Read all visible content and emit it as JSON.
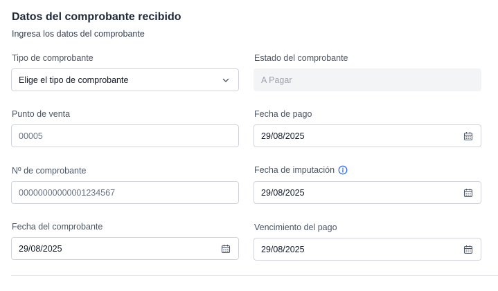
{
  "header": {
    "title": "Datos del comprobante recibido",
    "subtitle": "Ingresa los datos del comprobante"
  },
  "fields": {
    "tipo": {
      "label": "Tipo de comprobante",
      "value": "Elige el tipo de comprobante",
      "icon": "chevron-down-icon"
    },
    "estado": {
      "label": "Estado del comprobante",
      "value": "A Pagar"
    },
    "punto_venta": {
      "label": "Punto de venta",
      "value": "00005"
    },
    "fecha_pago": {
      "label": "Fecha de pago",
      "value": "29/08/2025",
      "icon": "calendar-icon"
    },
    "nro_comprobante": {
      "label": "Nº de comprobante",
      "value": "00000000000001234567"
    },
    "fecha_imputacion": {
      "label": "Fecha de imputación",
      "value": "29/08/2025",
      "icon": "calendar-icon",
      "info_icon": "info-icon"
    },
    "fecha_comprobante": {
      "label": "Fecha del comprobante",
      "value": "29/08/2025",
      "icon": "calendar-icon"
    },
    "vencimiento": {
      "label": "Vencimiento del pago",
      "value": "29/08/2025",
      "icon": "calendar-icon"
    }
  },
  "colors": {
    "accent": "#2563eb",
    "border": "#d1d5db",
    "disabled_bg": "#f3f4f6"
  }
}
